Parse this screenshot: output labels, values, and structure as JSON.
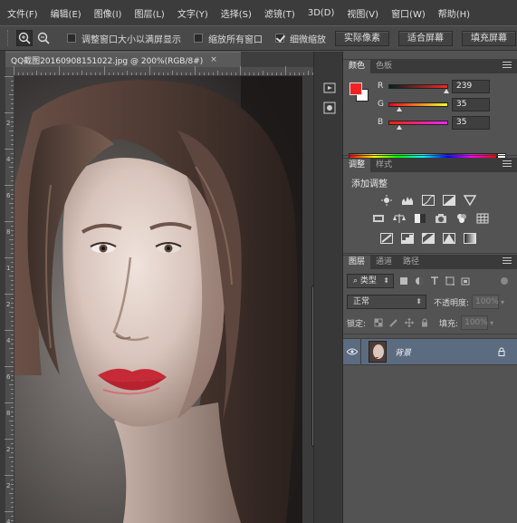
{
  "menu": [
    "文件(F)",
    "编辑(E)",
    "图像(I)",
    "图层(L)",
    "文字(Y)",
    "选择(S)",
    "滤镜(T)",
    "3D(D)",
    "视图(V)",
    "窗口(W)",
    "帮助(H)"
  ],
  "options": {
    "resize_windows": "调整窗口大小以满屏显示",
    "zoom_all": "缩放所有窗口",
    "scrubby_zoom": "细微缩放",
    "actual_pixels": "实际像素",
    "fit_screen": "适合屏幕",
    "fill_screen": "填充屏幕",
    "resize_checked": false,
    "zoom_all_checked": false,
    "scrubby_checked": true
  },
  "document": {
    "tab_title": "QQ截图20160908151022.jpg @ 200%(RGB/8#)",
    "ruler_h": [],
    "ruler_v": [
      "2",
      "4",
      "6",
      "8",
      "1",
      "2",
      "4",
      "6",
      "8",
      "2",
      "2",
      "4"
    ]
  },
  "color_panel": {
    "tabs": [
      "颜色",
      "色板"
    ],
    "foreground": "#ef2323",
    "background": "#ffffff",
    "r": {
      "label": "R",
      "value": "239"
    },
    "g": {
      "label": "G",
      "value": "35"
    },
    "b": {
      "label": "B",
      "value": "35"
    }
  },
  "adjust_panel": {
    "tabs": [
      "调整",
      "样式"
    ],
    "title": "添加调整"
  },
  "layers_panel": {
    "tabs": [
      "图层",
      "通道",
      "路径"
    ],
    "filter_kind": "类型",
    "blend_mode": "正常",
    "opacity_label": "不透明度:",
    "opacity_value": "100%",
    "lock_label": "锁定:",
    "fill_label": "填充:",
    "fill_value": "100%",
    "layer_name": "背景"
  }
}
